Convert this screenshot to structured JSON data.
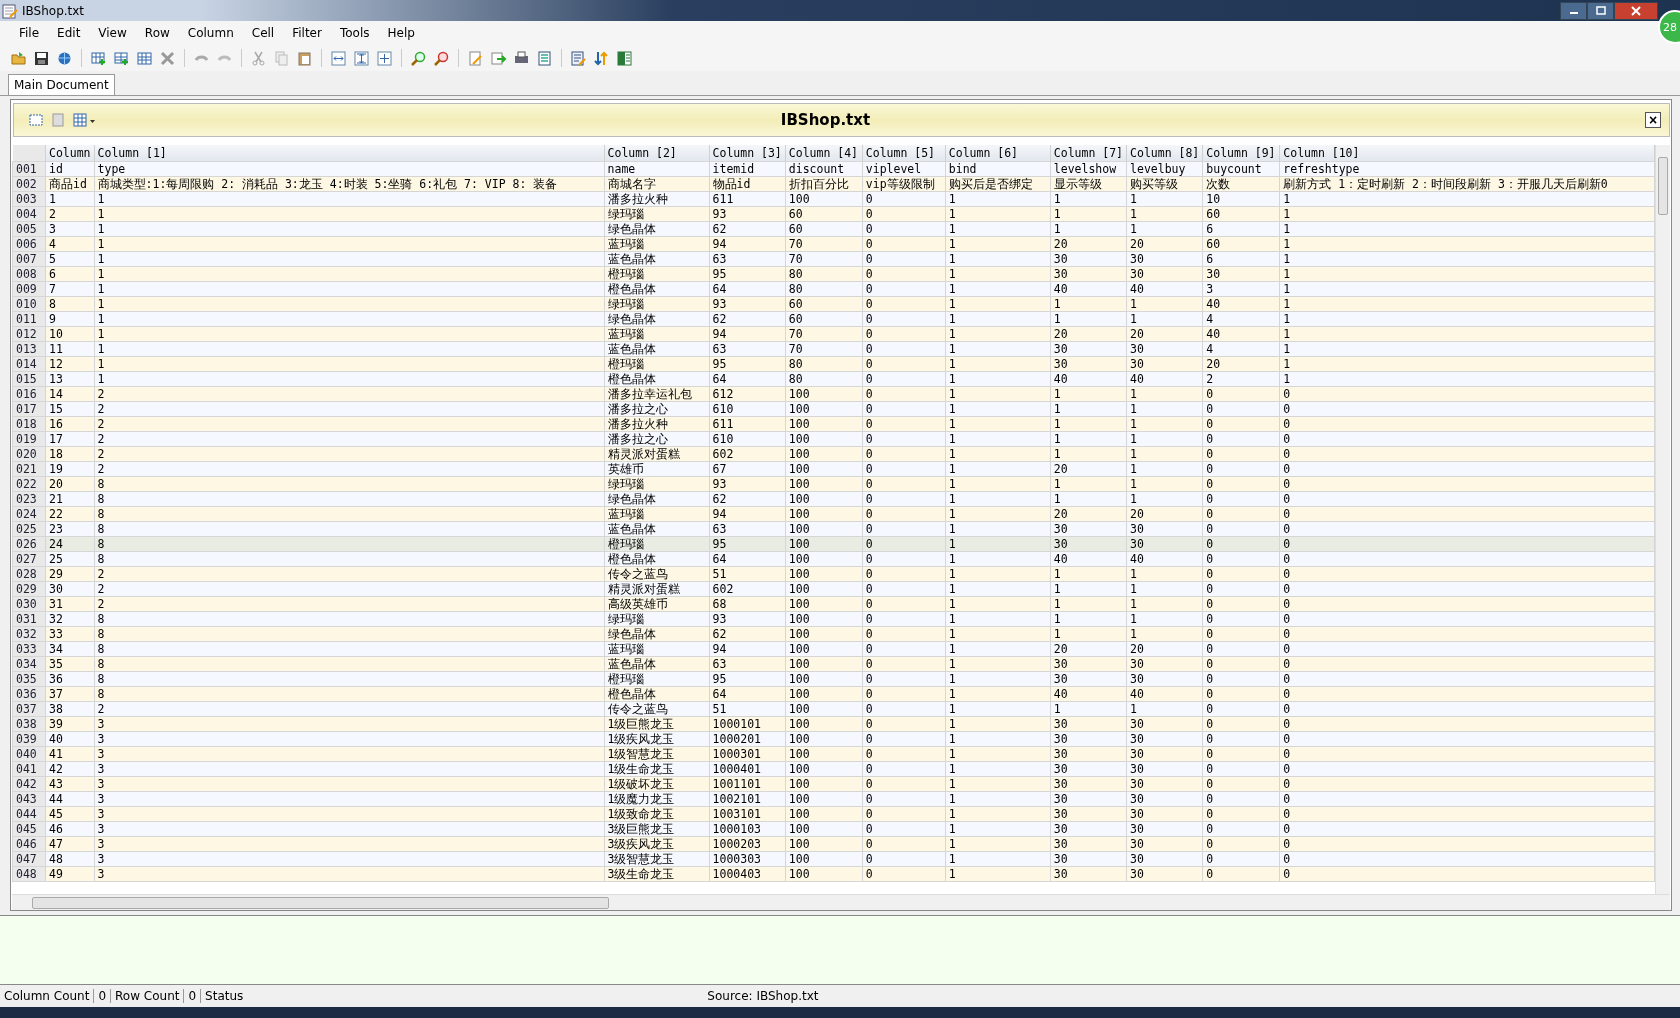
{
  "window": {
    "title": "IBShop.txt"
  },
  "badge": "28",
  "menu": [
    "File",
    "Edit",
    "View",
    "Row",
    "Column",
    "Cell",
    "Filter",
    "Tools",
    "Help"
  ],
  "tabs": [
    {
      "label": "Main Document",
      "selected": true
    }
  ],
  "document": {
    "title": "IBShop.txt",
    "close": "×"
  },
  "table": {
    "columns": [
      "Column",
      "Column [1]",
      "Column [2]",
      "Column [3]",
      "Column [4]",
      "Column [5]",
      "Column [6]",
      "Column [7]",
      "Column [8]",
      "Column [9]",
      "Column [10]"
    ],
    "rows": [
      {
        "num": "001",
        "selected": false,
        "cells": [
          "id",
          "type",
          "name",
          "itemid",
          "discount",
          "viplevel",
          "bind",
          "levelshow",
          "levelbuy",
          "buycount",
          "refreshtype"
        ]
      },
      {
        "num": "002",
        "selected": false,
        "cells": [
          "商品id",
          "商城类型:1:每周限购 2: 消耗品 3:龙玉 4:时装 5:坐骑 6:礼包 7: VIP 8: 装备",
          "商城名字",
          "物品id",
          "折扣百分比",
          "vip等级限制",
          "购买后是否绑定",
          "显示等级",
          "购买等级",
          "次数",
          "刷新方式 1：定时刷新 2：时间段刷新 3：开服几天后刷新0"
        ]
      },
      {
        "num": "003",
        "selected": false,
        "cells": [
          "1",
          "1",
          "潘多拉火种",
          "611",
          "100",
          "0",
          "1",
          "1",
          "1",
          "10",
          "1"
        ]
      },
      {
        "num": "004",
        "selected": false,
        "cells": [
          "2",
          "1",
          "绿玛瑙",
          "93",
          "60",
          "0",
          "1",
          "1",
          "1",
          "60",
          "1"
        ]
      },
      {
        "num": "005",
        "selected": false,
        "cells": [
          "3",
          "1",
          "绿色晶体",
          "62",
          "60",
          "0",
          "1",
          "1",
          "1",
          "6",
          "1"
        ]
      },
      {
        "num": "006",
        "selected": false,
        "cells": [
          "4",
          "1",
          "蓝玛瑙",
          "94",
          "70",
          "0",
          "1",
          "20",
          "20",
          "60",
          "1"
        ]
      },
      {
        "num": "007",
        "selected": false,
        "cells": [
          "5",
          "1",
          "蓝色晶体",
          "63",
          "70",
          "0",
          "1",
          "30",
          "30",
          "6",
          "1"
        ]
      },
      {
        "num": "008",
        "selected": false,
        "cells": [
          "6",
          "1",
          "橙玛瑙",
          "95",
          "80",
          "0",
          "1",
          "30",
          "30",
          "30",
          "1"
        ]
      },
      {
        "num": "009",
        "selected": false,
        "cells": [
          "7",
          "1",
          "橙色晶体",
          "64",
          "80",
          "0",
          "1",
          "40",
          "40",
          "3",
          "1"
        ]
      },
      {
        "num": "010",
        "selected": false,
        "cells": [
          "8",
          "1",
          "绿玛瑙",
          "93",
          "60",
          "0",
          "1",
          "1",
          "1",
          "40",
          "1"
        ]
      },
      {
        "num": "011",
        "selected": false,
        "cells": [
          "9",
          "1",
          "绿色晶体",
          "62",
          "60",
          "0",
          "1",
          "1",
          "1",
          "4",
          "1"
        ]
      },
      {
        "num": "012",
        "selected": false,
        "cells": [
          "10",
          "1",
          "蓝玛瑙",
          "94",
          "70",
          "0",
          "1",
          "20",
          "20",
          "40",
          "1"
        ]
      },
      {
        "num": "013",
        "selected": false,
        "cells": [
          "11",
          "1",
          "蓝色晶体",
          "63",
          "70",
          "0",
          "1",
          "30",
          "30",
          "4",
          "1"
        ]
      },
      {
        "num": "014",
        "selected": false,
        "cells": [
          "12",
          "1",
          "橙玛瑙",
          "95",
          "80",
          "0",
          "1",
          "30",
          "30",
          "20",
          "1"
        ]
      },
      {
        "num": "015",
        "selected": false,
        "cells": [
          "13",
          "1",
          "橙色晶体",
          "64",
          "80",
          "0",
          "1",
          "40",
          "40",
          "2",
          "1"
        ]
      },
      {
        "num": "016",
        "selected": false,
        "cells": [
          "14",
          "2",
          "潘多拉幸运礼包",
          "612",
          "100",
          "0",
          "1",
          "1",
          "1",
          "0",
          "0"
        ]
      },
      {
        "num": "017",
        "selected": false,
        "cells": [
          "15",
          "2",
          "潘多拉之心",
          "610",
          "100",
          "0",
          "1",
          "1",
          "1",
          "0",
          "0"
        ]
      },
      {
        "num": "018",
        "selected": false,
        "cells": [
          "16",
          "2",
          "潘多拉火种",
          "611",
          "100",
          "0",
          "1",
          "1",
          "1",
          "0",
          "0"
        ]
      },
      {
        "num": "019",
        "selected": false,
        "cells": [
          "17",
          "2",
          "潘多拉之心",
          "610",
          "100",
          "0",
          "1",
          "1",
          "1",
          "0",
          "0"
        ]
      },
      {
        "num": "020",
        "selected": false,
        "cells": [
          "18",
          "2",
          "精灵派对蛋糕",
          "602",
          "100",
          "0",
          "1",
          "1",
          "1",
          "0",
          "0"
        ]
      },
      {
        "num": "021",
        "selected": false,
        "cells": [
          "19",
          "2",
          "英雄币",
          "67",
          "100",
          "0",
          "1",
          "20",
          "1",
          "0",
          "0"
        ]
      },
      {
        "num": "022",
        "selected": false,
        "cells": [
          "20",
          "8",
          "绿玛瑙",
          "93",
          "100",
          "0",
          "1",
          "1",
          "1",
          "0",
          "0"
        ]
      },
      {
        "num": "023",
        "selected": false,
        "cells": [
          "21",
          "8",
          "绿色晶体",
          "62",
          "100",
          "0",
          "1",
          "1",
          "1",
          "0",
          "0"
        ]
      },
      {
        "num": "024",
        "selected": false,
        "cells": [
          "22",
          "8",
          "蓝玛瑙",
          "94",
          "100",
          "0",
          "1",
          "20",
          "20",
          "0",
          "0"
        ]
      },
      {
        "num": "025",
        "selected": false,
        "cells": [
          "23",
          "8",
          "蓝色晶体",
          "63",
          "100",
          "0",
          "1",
          "30",
          "30",
          "0",
          "0"
        ]
      },
      {
        "num": "026",
        "selected": true,
        "cells": [
          "24",
          "8",
          "橙玛瑙",
          "95",
          "100",
          "0",
          "1",
          "30",
          "30",
          "0",
          "0"
        ]
      },
      {
        "num": "027",
        "selected": false,
        "cells": [
          "25",
          "8",
          "橙色晶体",
          "64",
          "100",
          "0",
          "1",
          "40",
          "40",
          "0",
          "0"
        ]
      },
      {
        "num": "028",
        "selected": false,
        "cells": [
          "29",
          "2",
          "传令之蓝鸟",
          "51",
          "100",
          "0",
          "1",
          "1",
          "1",
          "0",
          "0"
        ]
      },
      {
        "num": "029",
        "selected": false,
        "cells": [
          "30",
          "2",
          "精灵派对蛋糕",
          "602",
          "100",
          "0",
          "1",
          "1",
          "1",
          "0",
          "0"
        ]
      },
      {
        "num": "030",
        "selected": false,
        "cells": [
          "31",
          "2",
          "高级英雄币",
          "68",
          "100",
          "0",
          "1",
          "1",
          "1",
          "0",
          "0"
        ]
      },
      {
        "num": "031",
        "selected": false,
        "cells": [
          "32",
          "8",
          "绿玛瑙",
          "93",
          "100",
          "0",
          "1",
          "1",
          "1",
          "0",
          "0"
        ]
      },
      {
        "num": "032",
        "selected": false,
        "cells": [
          "33",
          "8",
          "绿色晶体",
          "62",
          "100",
          "0",
          "1",
          "1",
          "1",
          "0",
          "0"
        ]
      },
      {
        "num": "033",
        "selected": false,
        "cells": [
          "34",
          "8",
          "蓝玛瑙",
          "94",
          "100",
          "0",
          "1",
          "20",
          "20",
          "0",
          "0"
        ]
      },
      {
        "num": "034",
        "selected": false,
        "cells": [
          "35",
          "8",
          "蓝色晶体",
          "63",
          "100",
          "0",
          "1",
          "30",
          "30",
          "0",
          "0"
        ]
      },
      {
        "num": "035",
        "selected": false,
        "cells": [
          "36",
          "8",
          "橙玛瑙",
          "95",
          "100",
          "0",
          "1",
          "30",
          "30",
          "0",
          "0"
        ]
      },
      {
        "num": "036",
        "selected": false,
        "cells": [
          "37",
          "8",
          "橙色晶体",
          "64",
          "100",
          "0",
          "1",
          "40",
          "40",
          "0",
          "0"
        ]
      },
      {
        "num": "037",
        "selected": false,
        "cells": [
          "38",
          "2",
          "传令之蓝鸟",
          "51",
          "100",
          "0",
          "1",
          "1",
          "1",
          "0",
          "0"
        ]
      },
      {
        "num": "038",
        "selected": false,
        "cells": [
          "39",
          "3",
          "1级巨熊龙玉",
          "1000101",
          "100",
          "0",
          "1",
          "30",
          "30",
          "0",
          "0"
        ]
      },
      {
        "num": "039",
        "selected": false,
        "cells": [
          "40",
          "3",
          "1级疾风龙玉",
          "1000201",
          "100",
          "0",
          "1",
          "30",
          "30",
          "0",
          "0"
        ]
      },
      {
        "num": "040",
        "selected": false,
        "cells": [
          "41",
          "3",
          "1级智慧龙玉",
          "1000301",
          "100",
          "0",
          "1",
          "30",
          "30",
          "0",
          "0"
        ]
      },
      {
        "num": "041",
        "selected": false,
        "cells": [
          "42",
          "3",
          "1级生命龙玉",
          "1000401",
          "100",
          "0",
          "1",
          "30",
          "30",
          "0",
          "0"
        ]
      },
      {
        "num": "042",
        "selected": false,
        "cells": [
          "43",
          "3",
          "1级破坏龙玉",
          "1001101",
          "100",
          "0",
          "1",
          "30",
          "30",
          "0",
          "0"
        ]
      },
      {
        "num": "043",
        "selected": false,
        "cells": [
          "44",
          "3",
          "1级魔力龙玉",
          "1002101",
          "100",
          "0",
          "1",
          "30",
          "30",
          "0",
          "0"
        ]
      },
      {
        "num": "044",
        "selected": false,
        "cells": [
          "45",
          "3",
          "1级致命龙玉",
          "1003101",
          "100",
          "0",
          "1",
          "30",
          "30",
          "0",
          "0"
        ]
      },
      {
        "num": "045",
        "selected": false,
        "cells": [
          "46",
          "3",
          "3级巨熊龙玉",
          "1000103",
          "100",
          "0",
          "1",
          "30",
          "30",
          "0",
          "0"
        ]
      },
      {
        "num": "046",
        "selected": false,
        "cells": [
          "47",
          "3",
          "3级疾风龙玉",
          "1000203",
          "100",
          "0",
          "1",
          "30",
          "30",
          "0",
          "0"
        ]
      },
      {
        "num": "047",
        "selected": false,
        "cells": [
          "48",
          "3",
          "3级智慧龙玉",
          "1000303",
          "100",
          "0",
          "1",
          "30",
          "30",
          "0",
          "0"
        ]
      },
      {
        "num": "048",
        "selected": false,
        "cells": [
          "49",
          "3",
          "3级生命龙玉",
          "1000403",
          "100",
          "0",
          "1",
          "30",
          "30",
          "0",
          "0"
        ]
      }
    ]
  },
  "status_bar": {
    "items": [
      {
        "label": "Column Count",
        "value": "0"
      },
      {
        "label": "Row Count",
        "value": "0"
      },
      {
        "label": "Status"
      }
    ],
    "source": "Source: IBShop.txt"
  }
}
